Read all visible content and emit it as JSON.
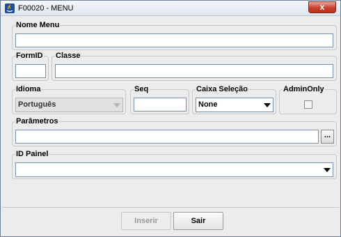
{
  "window": {
    "title": "F00020 - MENU",
    "close_glyph": "x",
    "icon": "java-app-icon"
  },
  "form": {
    "nome_menu": {
      "label": "Nome Menu",
      "value": ""
    },
    "form_id": {
      "label": "FormID",
      "value": ""
    },
    "classe": {
      "label": "Classe",
      "value": ""
    },
    "idioma": {
      "label": "Idioma",
      "selected": "Português",
      "enabled": false
    },
    "seq": {
      "label": "Seq",
      "value": ""
    },
    "caixa_selecao": {
      "label": "Caixa Seleção",
      "selected": "None"
    },
    "admin_only": {
      "label": "AdminOnly",
      "checked": false
    },
    "parametros": {
      "label": "Parâmetros",
      "value": "",
      "browse_label": "..."
    },
    "id_painel": {
      "label": "ID Painel",
      "selected": ""
    }
  },
  "buttons": {
    "inserir": {
      "label": "Inserir",
      "enabled": false
    },
    "sair": {
      "label": "Sair",
      "enabled": true
    }
  }
}
